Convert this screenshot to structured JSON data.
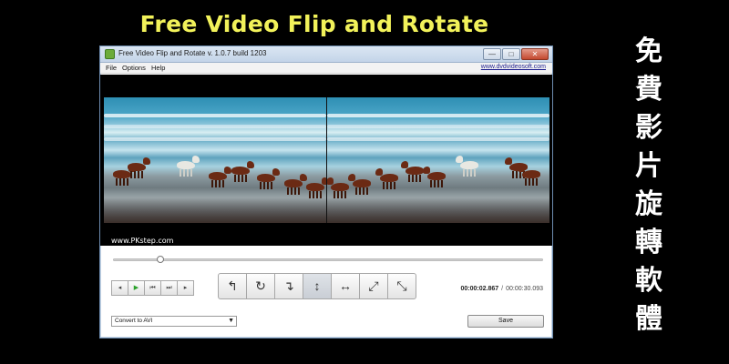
{
  "promo": {
    "title": "Free Video Flip and Rotate",
    "vertical_chars": [
      "免",
      "費",
      "影",
      "片",
      "旋",
      "轉",
      "軟",
      "體"
    ]
  },
  "window": {
    "title": "Free Video Flip and Rotate v. 1.0.7 build 1203",
    "controls": {
      "minimize": "—",
      "maximize": "□",
      "close": "✕"
    }
  },
  "menu": {
    "items": [
      "File",
      "Options",
      "Help"
    ],
    "site_link": "www.dvdvideosoft.com"
  },
  "video": {
    "watermark": "www.PKstep.com"
  },
  "seek": {
    "position_fraction": 0.11
  },
  "transport": {
    "buttons": [
      {
        "name": "step-back",
        "glyph": "◂"
      },
      {
        "name": "play",
        "glyph": "▶"
      },
      {
        "name": "prev",
        "glyph": "⏮"
      },
      {
        "name": "next",
        "glyph": "⏭"
      },
      {
        "name": "step-forward",
        "glyph": "▸"
      }
    ]
  },
  "rotate_tools": [
    {
      "name": "rotate-left",
      "glyph": "↰"
    },
    {
      "name": "rotate-right",
      "glyph": "↻"
    },
    {
      "name": "rotate-180",
      "glyph": "↴"
    },
    {
      "name": "flip-vertical",
      "glyph": "↕"
    },
    {
      "name": "flip-horizontal",
      "glyph": "↔"
    },
    {
      "name": "transpose",
      "glyph": "⤢"
    },
    {
      "name": "transverse",
      "glyph": "⤡"
    }
  ],
  "time": {
    "current": "00:00:02.867",
    "separator": "/",
    "total": "00:00:30.093"
  },
  "output": {
    "format": "Convert to AVI",
    "save_label": "Save"
  }
}
